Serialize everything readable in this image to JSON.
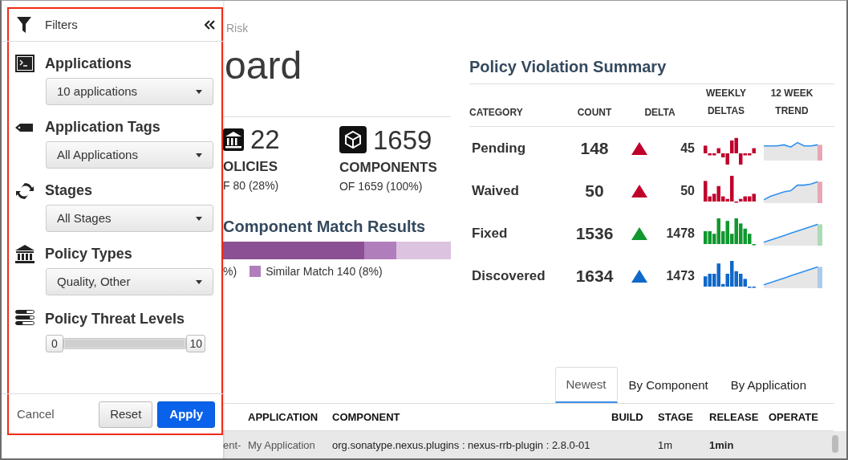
{
  "filters": {
    "title": "Filters",
    "sections": [
      {
        "kind": "dropdown",
        "label": "Applications",
        "value": "10 applications"
      },
      {
        "kind": "dropdown",
        "label": "Application Tags",
        "value": "All Applications"
      },
      {
        "kind": "dropdown",
        "label": "Stages",
        "value": "All Stages"
      },
      {
        "kind": "dropdown",
        "label": "Policy Types",
        "value": "Quality, Other"
      },
      {
        "kind": "range",
        "label": "Policy Threat Levels",
        "min_label": "0",
        "max_label": "10",
        "level": 1
      }
    ],
    "buttons": [
      {
        "kind": "link",
        "label": "Cancel"
      },
      {
        "kind": "default",
        "label": "Reset"
      },
      {
        "kind": "primary",
        "label": "Apply"
      }
    ]
  },
  "breadcrumb": "Risk",
  "title": "oard",
  "stats": [
    {
      "value": "22",
      "label": "OLICIES",
      "sub": "F 80 (28%)"
    },
    {
      "value": "1659",
      "label": "COMPONENTS",
      "sub": "OF 1659 (100%)"
    }
  ],
  "match": {
    "title": "Component Match Results",
    "segments": [
      {
        "level": 0.62,
        "color": "#8b4f93"
      },
      {
        "level": 0.76,
        "color": "#b07fbb"
      },
      {
        "color": "#dcc3e0"
      }
    ],
    "legend": [
      {
        "text": "%)"
      },
      {
        "text": "Similar Match 140 (8%)",
        "color": "#b07fbb"
      }
    ]
  },
  "violations": {
    "title": "Policy Violation Summary",
    "columns": [
      "CATEGORY",
      "COUNT",
      "DELTA",
      "WEEKLY DELTAS",
      "12 WEEK TREND"
    ],
    "rows": [
      {
        "category": "Pending",
        "count": "148",
        "delta": "45",
        "color": "#c0002c"
      },
      {
        "category": "Waived",
        "count": "50",
        "delta": "50",
        "color": "#c0002c"
      },
      {
        "category": "Fixed",
        "count": "1536",
        "delta": "1478",
        "color": "#10982f"
      },
      {
        "category": "Discovered",
        "count": "1634",
        "delta": "1473",
        "color": "#1068c8"
      }
    ]
  },
  "tabs": [
    {
      "label": "Newest",
      "selected": true
    },
    {
      "label": "By Component",
      "selected": false
    },
    {
      "label": "By Application",
      "selected": false
    }
  ],
  "table": {
    "columns": [
      "APPLICATION",
      "COMPONENT",
      "BUILD",
      "STAGE",
      "RELEASE",
      "OPERATE"
    ],
    "rows": [
      {
        "column_1": "ent-",
        "application": "My Application",
        "component": "org.sonatype.nexus.plugins : nexus-rrb-plugin : 2.8.0-01",
        "stage": "1m",
        "release": "1min"
      }
    ]
  }
}
